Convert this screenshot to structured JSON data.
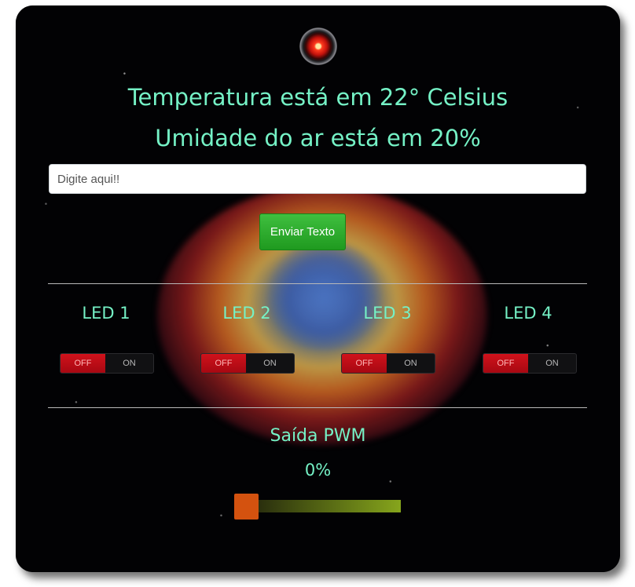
{
  "header": {
    "logo_icon": "hal-eye-icon",
    "temperature_text": "Temperatura está em 22° Celsius",
    "humidity_text": "Umidade do ar está em 20%"
  },
  "message": {
    "placeholder": "Digite aqui!!",
    "value": "",
    "send_label": "Enviar Texto"
  },
  "leds": [
    {
      "label": "LED 1",
      "off_label": "OFF",
      "on_label": "ON",
      "state": "OFF"
    },
    {
      "label": "LED 2",
      "off_label": "OFF",
      "on_label": "ON",
      "state": "OFF"
    },
    {
      "label": "LED 3",
      "off_label": "OFF",
      "on_label": "ON",
      "state": "OFF"
    },
    {
      "label": "LED 4",
      "off_label": "OFF",
      "on_label": "ON",
      "state": "OFF"
    }
  ],
  "pwm": {
    "title": "Saída PWM",
    "value_text": "0%",
    "value": 0
  },
  "colors": {
    "accent_text": "#75f2c6",
    "button_green": "#2aa92a",
    "toggle_off_red": "#c20f18",
    "slider_thumb": "#d4520f",
    "slider_track_end": "#86a51c"
  }
}
